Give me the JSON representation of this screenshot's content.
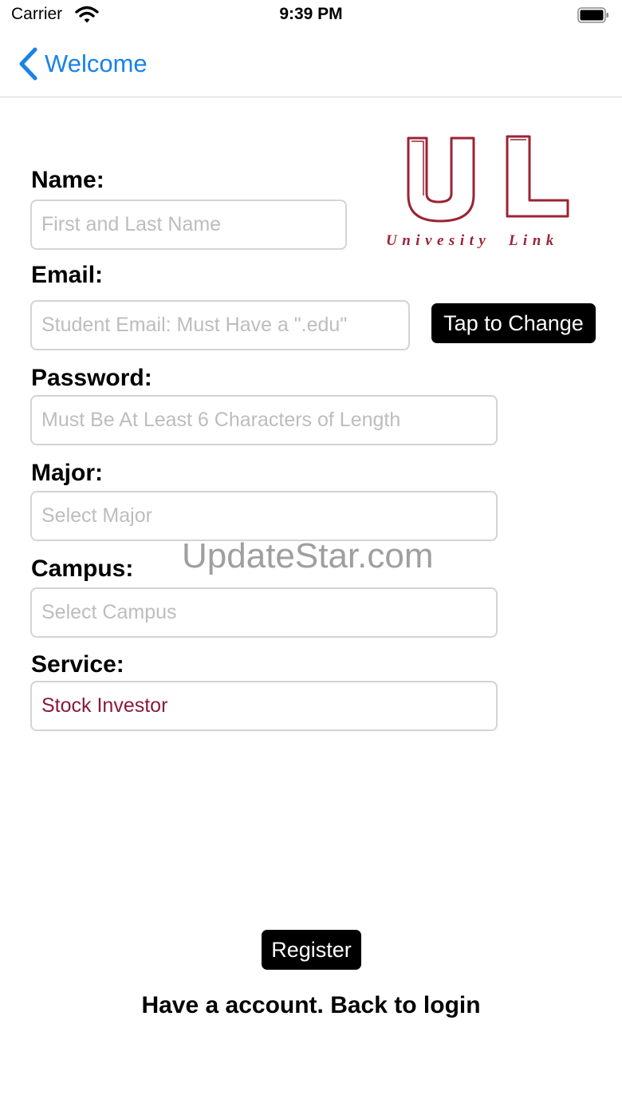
{
  "status_bar": {
    "carrier": "Carrier",
    "time": "9:39 PM"
  },
  "nav": {
    "back_label": "Welcome"
  },
  "logo": {
    "letters": "U L",
    "subtitle": "Univesity  Link",
    "color": "#9b2335"
  },
  "form": {
    "name": {
      "label": "Name:",
      "placeholder": "First and Last Name"
    },
    "email": {
      "label": "Email:",
      "placeholder": "Student Email: Must Have a \".edu\""
    },
    "password": {
      "label": "Password:",
      "placeholder": "Must Be At Least 6 Characters of Length"
    },
    "major": {
      "label": "Major:",
      "placeholder": "Select Major"
    },
    "campus": {
      "label": "Campus:",
      "placeholder": "Select Campus"
    },
    "service": {
      "label": "Service:",
      "value": "Stock Investor"
    }
  },
  "tap_to_change_label": "Tap to Change",
  "register_label": "Register",
  "back_to_login_label": "Have a account. Back to login",
  "watermark": "UpdateStar.com",
  "colors": {
    "accent": "#1a82e6",
    "brand": "#9b2335",
    "input_text": "#8b1a3e"
  }
}
